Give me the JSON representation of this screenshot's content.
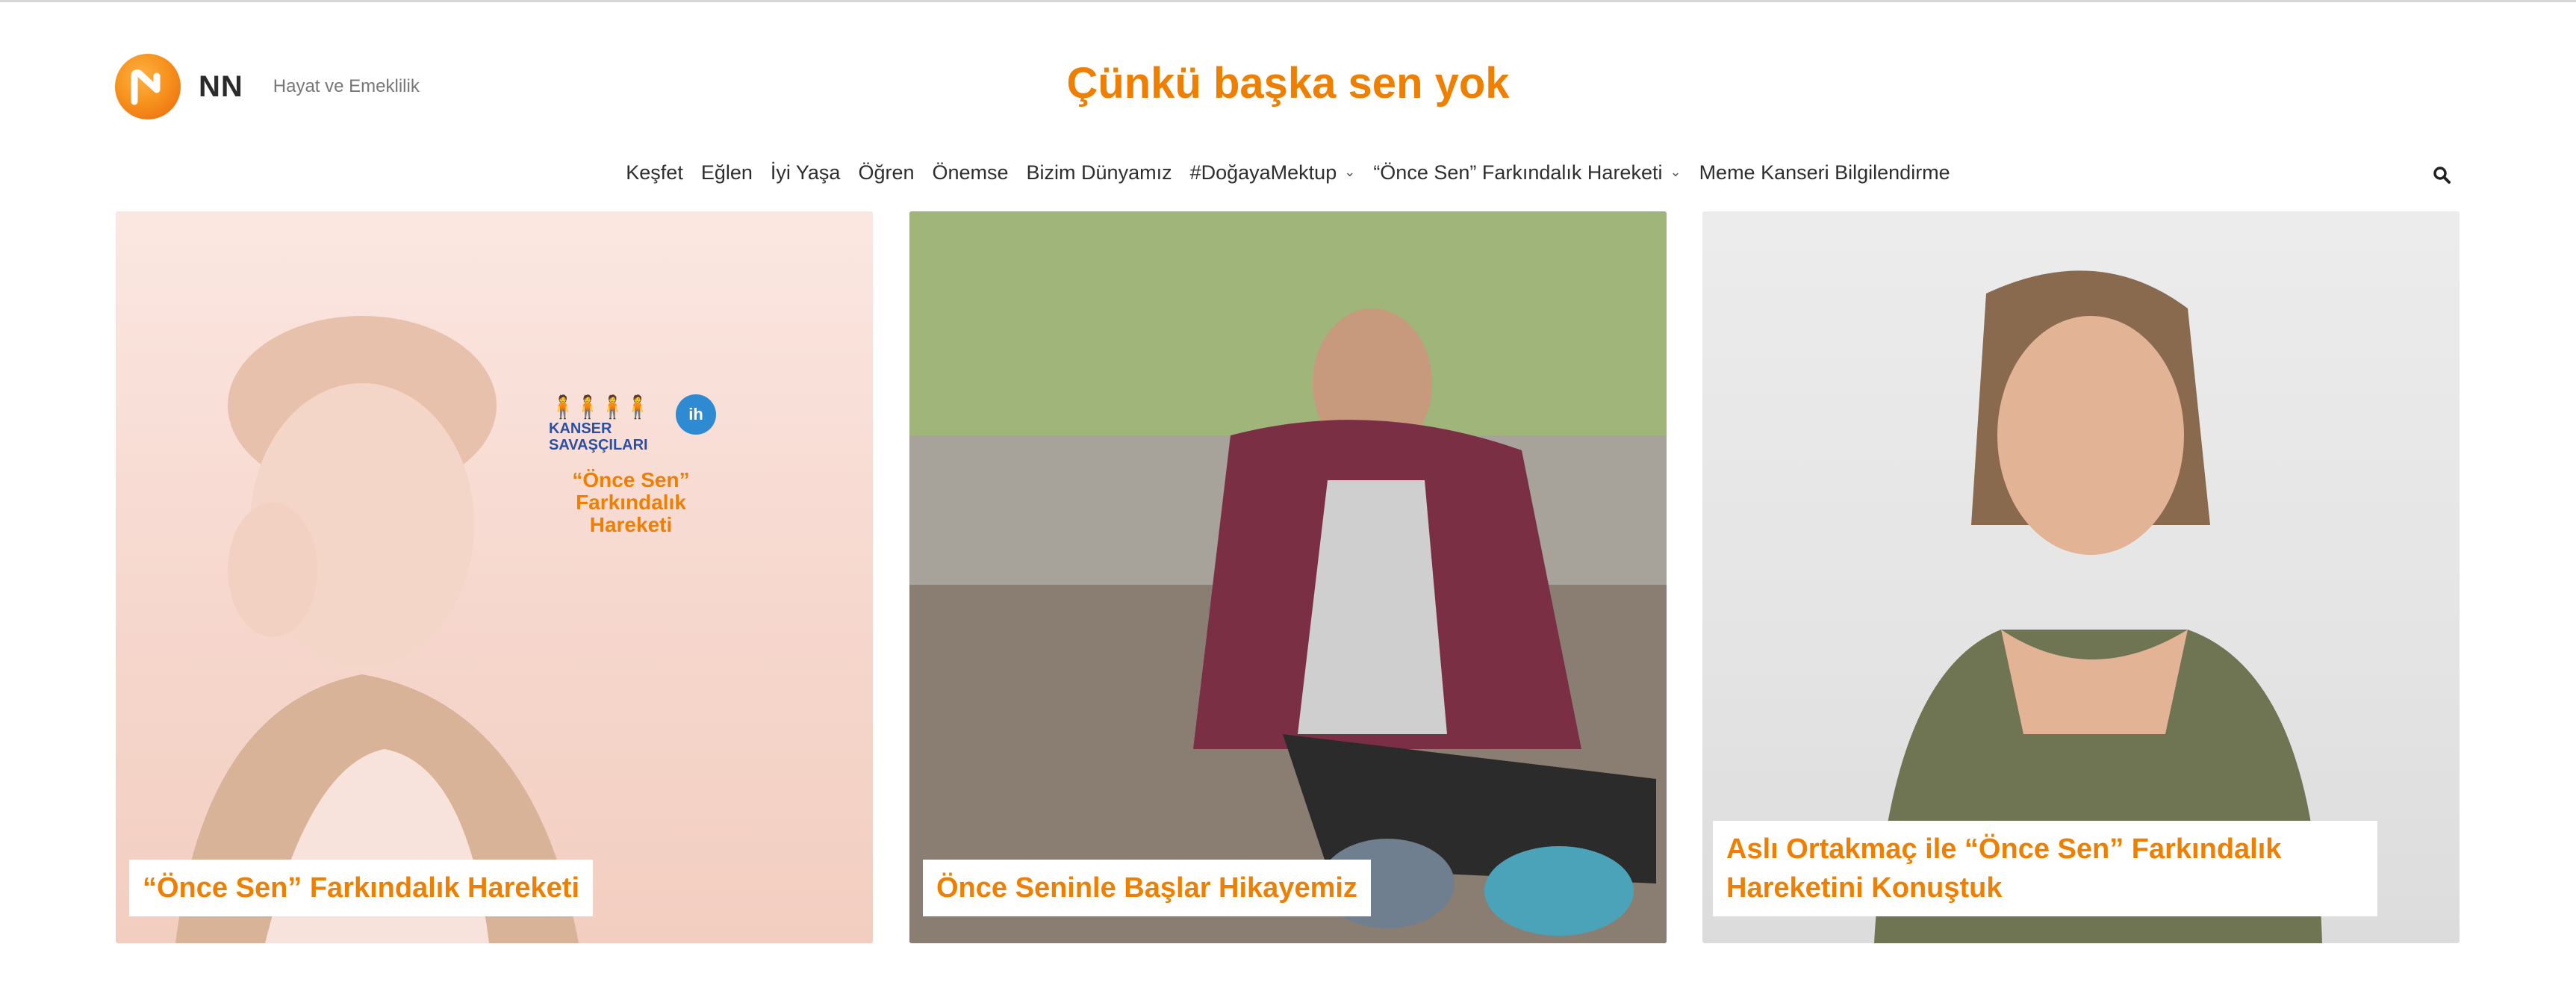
{
  "brand": {
    "logo_text": "NN",
    "subtitle": "Hayat ve Emeklilik",
    "tagline": "Çünkü başka sen yok",
    "accent": "#ee7f00"
  },
  "nav": {
    "items": [
      {
        "label": "Keşfet"
      },
      {
        "label": "Eğlen"
      },
      {
        "label": "İyi Yaşa"
      },
      {
        "label": "Öğren"
      },
      {
        "label": "Önemse"
      },
      {
        "label": "Bizim Dünyamız"
      },
      {
        "label": "#DoğayaMektup",
        "dropdown": true
      },
      {
        "label": "“Önce Sen” Farkındalık Hareketi",
        "dropdown": true
      },
      {
        "label": "Meme Kanseri Bilgilendirme"
      }
    ],
    "search_icon": "search-icon"
  },
  "cards": [
    {
      "title": "“Önce Sen” Farkındalık Hareketi",
      "overlay": {
        "org_line1": "KANSER",
        "org_line2": "SAVAŞÇILARI",
        "badge": "ih",
        "campaign_line1": "“Önce Sen”",
        "campaign_line2": "Farkındalık",
        "campaign_line3": "Hareketi"
      }
    },
    {
      "title": "Önce Seninle Başlar Hikayemiz"
    },
    {
      "title": "Aslı Ortakmaç ile “Önce Sen” Farkındalık Hareketini Konuştuk"
    }
  ]
}
